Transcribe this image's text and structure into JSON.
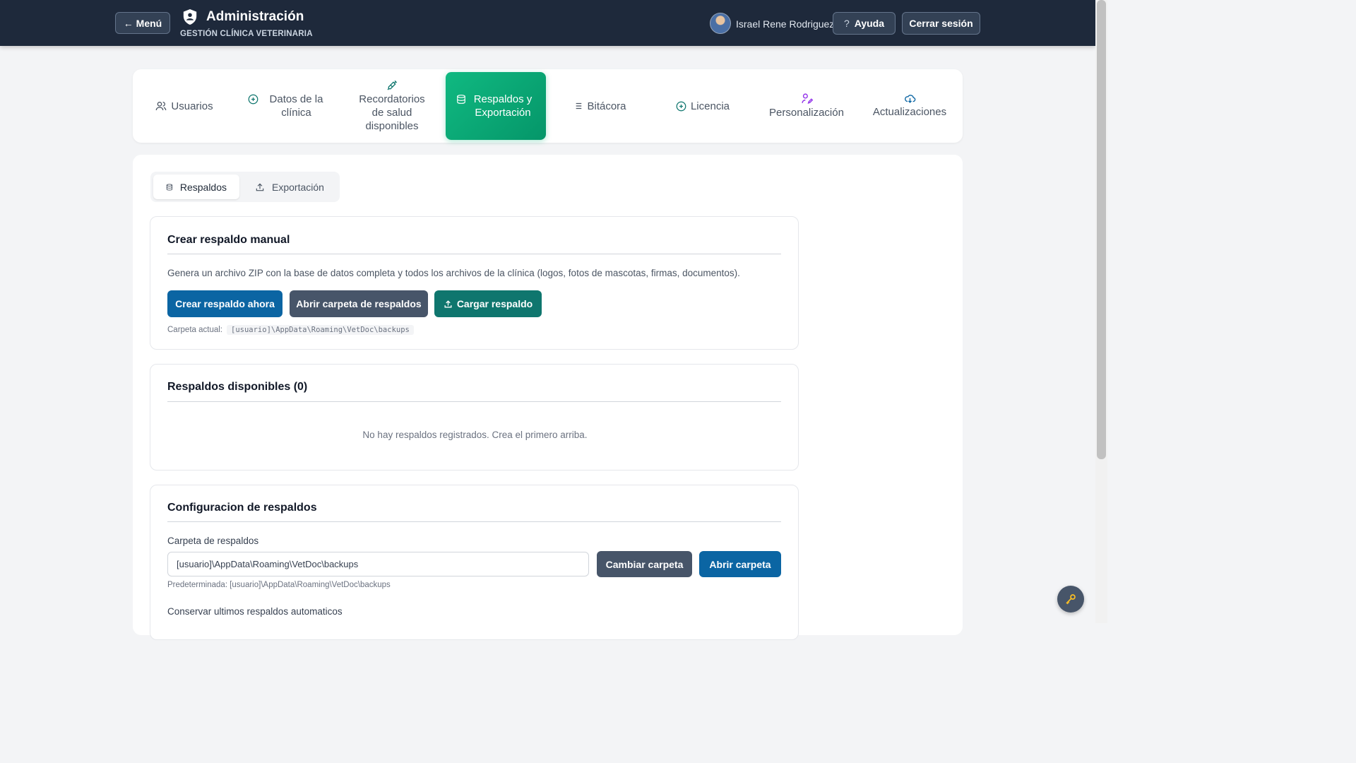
{
  "header": {
    "menu_label": "← Menú",
    "title": "Administración",
    "subtitle": "GESTIÓN CLÍNICA VETERINARIA",
    "user_name": "Israel Rene Rodriguez",
    "help_label": "Ayuda",
    "help_glyph": "?",
    "logout_label": "Cerrar sesión"
  },
  "tabs": [
    {
      "label": "Usuarios",
      "icon": "users-icon"
    },
    {
      "label": "Datos de la clínica",
      "icon": "plus-circle-icon"
    },
    {
      "label": "Recordatorios de salud disponibles",
      "icon": "syringe-icon"
    },
    {
      "label": "Respaldos y Exportación",
      "icon": "database-icon",
      "active": true
    },
    {
      "label": "Bitácora",
      "icon": "list-icon"
    },
    {
      "label": "Licencia",
      "icon": "plus-circle-icon"
    },
    {
      "label": "Personalización",
      "icon": "user-edit-icon"
    },
    {
      "label": "Actualizaciones",
      "icon": "cloud-download-icon"
    }
  ],
  "subtabs": {
    "respaldos": "Respaldos",
    "exportacion": "Exportación"
  },
  "manual_backup": {
    "title": "Crear respaldo manual",
    "description": "Genera un archivo ZIP con la base de datos completa y todos los archivos de la clínica (logos, fotos de mascotas, firmas, documentos).",
    "create_button": "Crear respaldo ahora",
    "open_folder_button": "Abrir carpeta de respaldos",
    "upload_button": "Cargar respaldo",
    "current_folder_label": "Carpeta actual:",
    "current_folder_path": "[usuario]\\AppData\\Roaming\\VetDoc\\backups"
  },
  "available_backups": {
    "title": "Respaldos disponibles (0)",
    "empty_message": "No hay respaldos registrados. Crea el primero arriba."
  },
  "config": {
    "title": "Configuracion de respaldos",
    "folder_label": "Carpeta de respaldos",
    "folder_value": "[usuario]\\AppData\\Roaming\\VetDoc\\backups",
    "change_folder_button": "Cambiar carpeta",
    "open_folder_button": "Abrir carpeta",
    "default_hint": "Predeterminada: [usuario]\\AppData\\Roaming\\VetDoc\\backups",
    "keep_label": "Conservar ultimos respaldos automaticos"
  },
  "colors": {
    "header_bg": "#1e293b",
    "active_tab": "#10b981",
    "primary_blue": "#0b65a3",
    "slate": "#475569",
    "teal": "#0f766e"
  }
}
